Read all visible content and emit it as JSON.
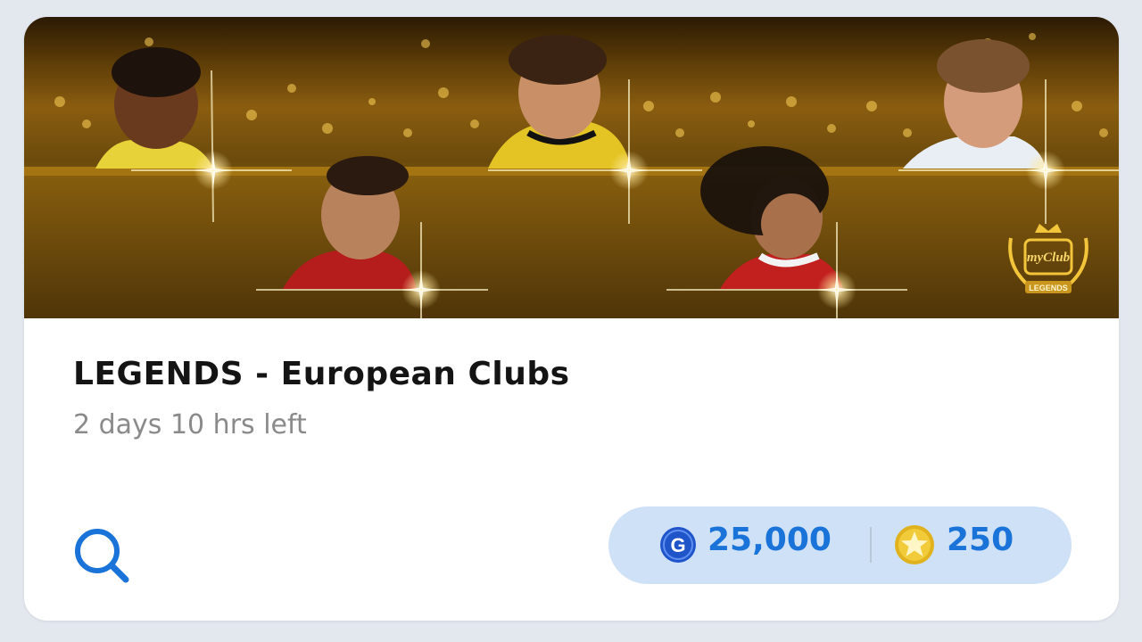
{
  "pack": {
    "title": "LEGENDS - European Clubs",
    "time_left": "2 days 10 hrs left"
  },
  "banner": {
    "badge_top": "myClub",
    "badge_bottom": "LEGENDS"
  },
  "price": {
    "gp_symbol": "G",
    "gp_amount": "25,000",
    "coin_amount": "250"
  },
  "icons": {
    "search": "search-icon",
    "gp": "gp-coin-icon",
    "coin": "star-coin-icon"
  },
  "colors": {
    "accent": "#1a73d8",
    "pill_background": "#cfe1f6",
    "gp_coin": "#1f55c9",
    "star_coin": "#e0b21e",
    "title": "#141414",
    "subtitle": "#8a8a8a"
  }
}
